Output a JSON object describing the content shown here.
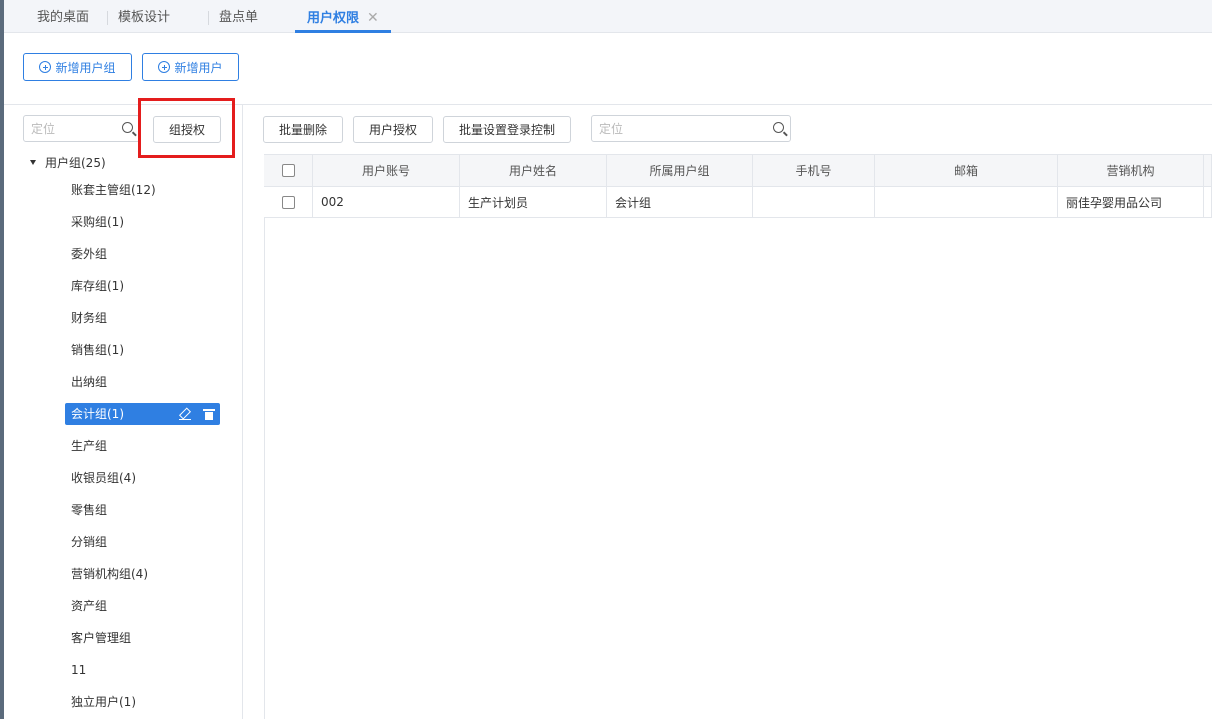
{
  "tabs": [
    {
      "label": "我的桌面"
    },
    {
      "label": "模板设计"
    },
    {
      "label": "盘点单"
    },
    {
      "label": "用户权限",
      "close": "✕"
    }
  ],
  "toolbar": {
    "add_group_label": "新增用户组",
    "add_user_label": "新增用户"
  },
  "left_panel": {
    "search_placeholder": "定位",
    "group_auth_label": "组授权",
    "root_label": "用户组(25)",
    "groups": [
      "账套主管组(12)",
      "采购组(1)",
      "委外组",
      "库存组(1)",
      "财务组",
      "销售组(1)",
      "出纳组",
      "会计组(1)",
      "生产组",
      "收银员组(4)",
      "零售组",
      "分销组",
      "营销机构组(4)",
      "资产组",
      "客户管理组",
      "11",
      "独立用户(1)"
    ],
    "selected_group": "会计组(1)"
  },
  "right_panel": {
    "batch_delete_label": "批量删除",
    "user_auth_label": "用户授权",
    "batch_login_label": "批量设置登录控制",
    "search_placeholder": "定位",
    "columns": [
      "用户账号",
      "用户姓名",
      "所属用户组",
      "手机号",
      "邮箱",
      "营销机构"
    ],
    "rows": [
      {
        "account": "002",
        "name": "生产计划员",
        "group": "会计组",
        "phone": "",
        "email": "",
        "org": "丽佳孕婴用品公司"
      }
    ]
  },
  "colors": {
    "accent": "#2f7fe2",
    "highlight": "#e41d1d"
  }
}
